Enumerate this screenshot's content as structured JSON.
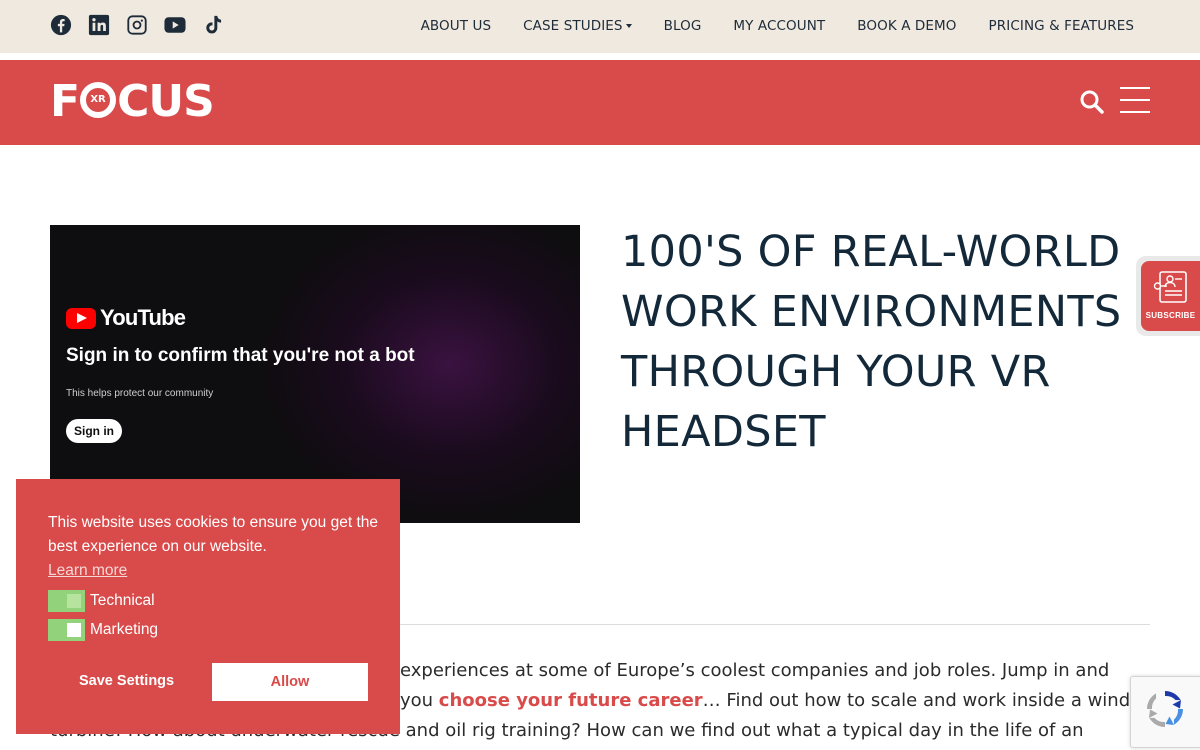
{
  "social": {
    "icons": [
      "facebook-icon",
      "linkedin-icon",
      "instagram-icon",
      "youtube-icon",
      "tiktok-icon"
    ]
  },
  "topnav": {
    "items": [
      "ABOUT US",
      "CASE STUDIES",
      "BLOG",
      "MY ACCOUNT",
      "BOOK A DEMO",
      "PRICING & FEATURES"
    ]
  },
  "header": {
    "logo_text_start": "F",
    "logo_text_end": "CUS",
    "logo_badge": "XR",
    "color": "#d94a4a"
  },
  "video": {
    "brand": "YouTube",
    "title": "Sign in to confirm that you're not a bot",
    "subtitle": "This helps protect our community",
    "button": "Sign in"
  },
  "hero": {
    "heading": "100'S OF REAL-WORLD WORK ENVIRONMENTS THROUGH YOUR VR HEADSET"
  },
  "subscribe": {
    "label": "SUBSCRIBE"
  },
  "intro": {
    "line1": "experiences at some of Europe’s coolest companies and job roles. Jump in and",
    "line2_before": "you ",
    "line2_link": "choose your future career",
    "line2_after": "… Find out how to scale and work inside a wind",
    "line3": "turbine! How about underwater rescue and oil rig training? How can we find out what a typical day in the life of an"
  },
  "cookie": {
    "message": "This website uses cookies to ensure you get the best experience on our website.",
    "learn_more": "Learn more",
    "options": [
      {
        "label": "Technical",
        "state": "on"
      },
      {
        "label": "Marketing",
        "state": "off"
      }
    ],
    "save_label": "Save Settings",
    "allow_label": "Allow",
    "toggle_color": "#92d27a"
  }
}
